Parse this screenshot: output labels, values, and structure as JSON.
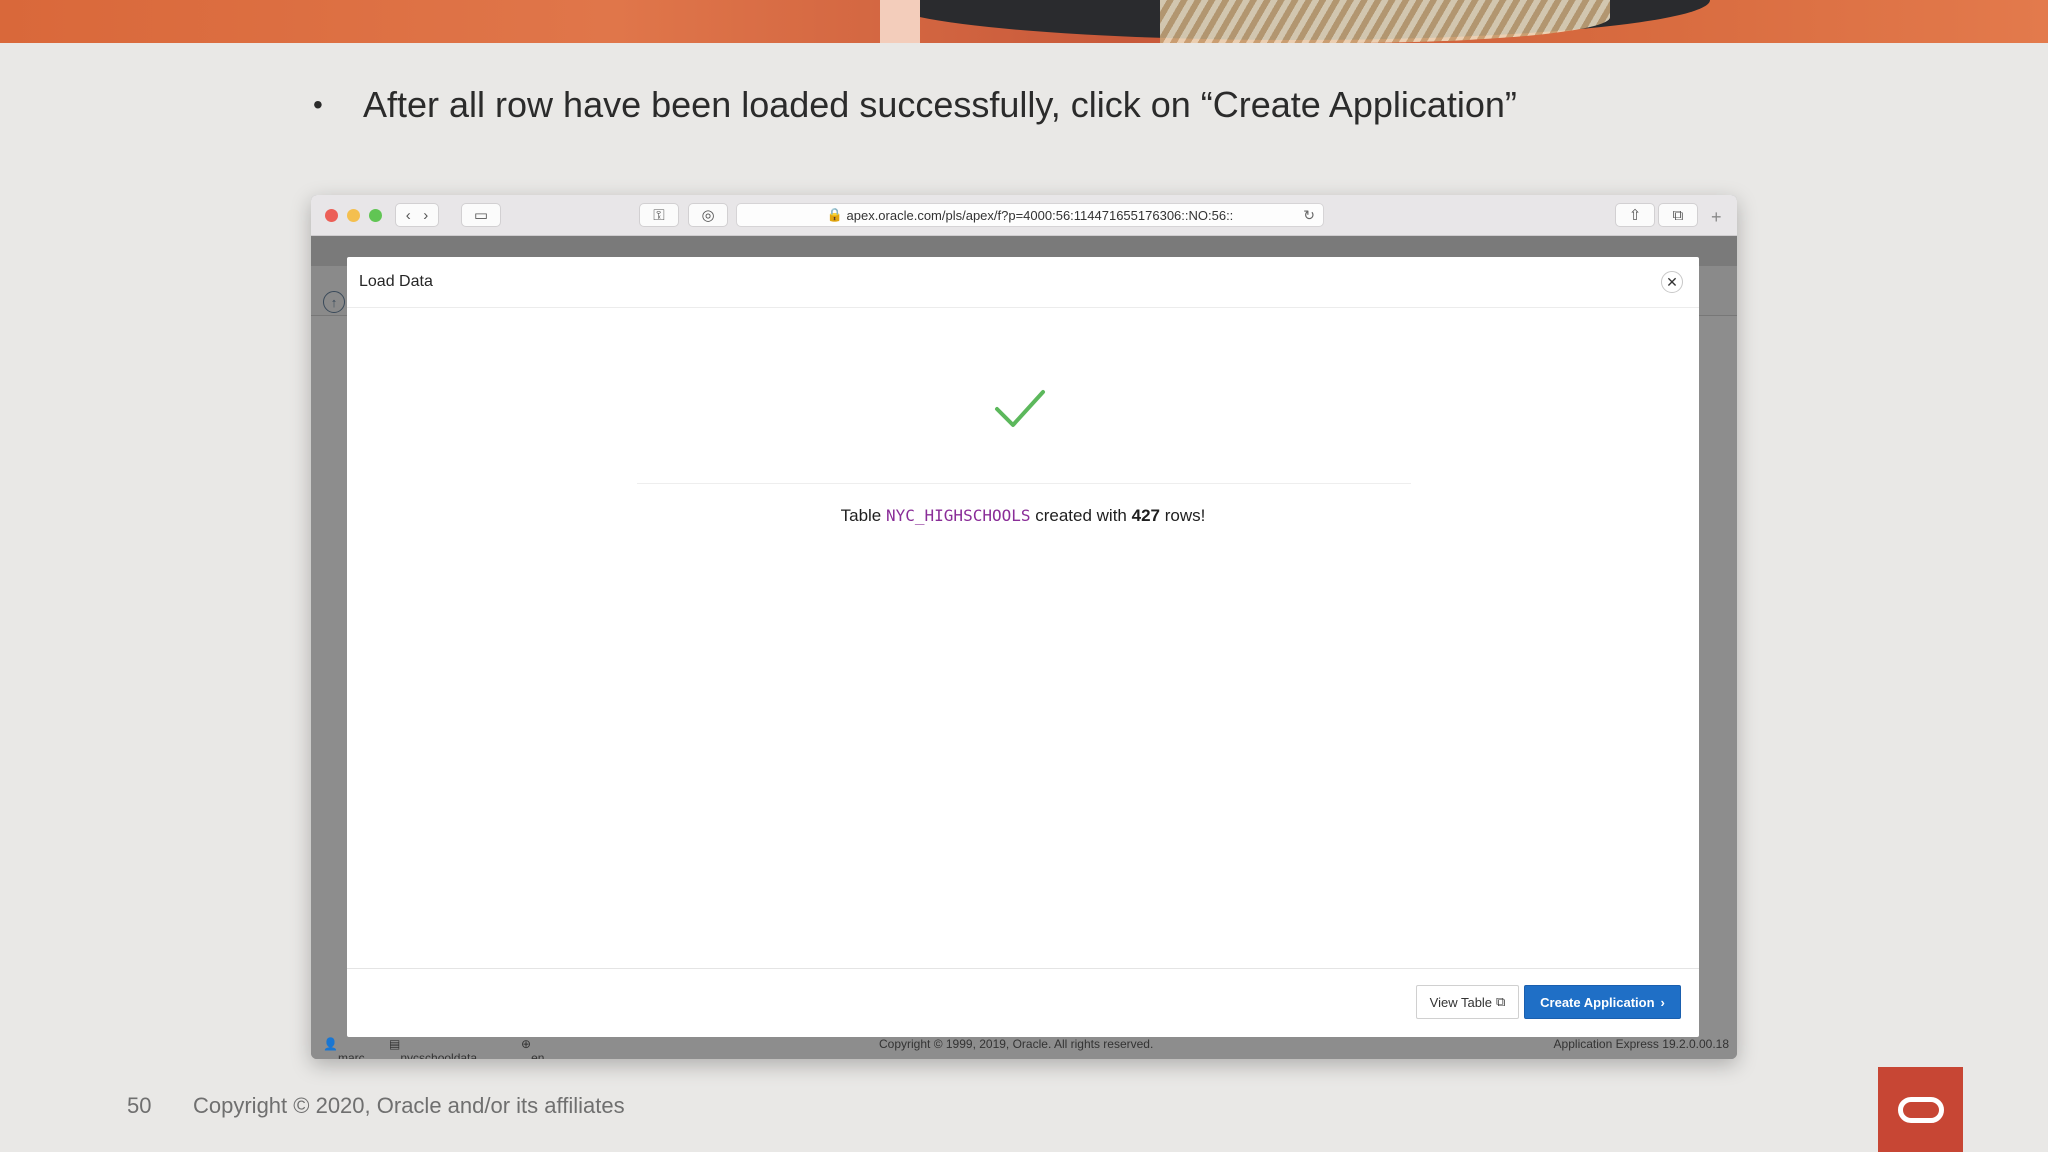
{
  "slide": {
    "bullet_text": "After all row have been loaded successfully, click on “Create Application”",
    "page_number": "50",
    "copyright": "Copyright © 2020, Oracle and/or its affiliates"
  },
  "browser": {
    "url": "apex.oracle.com/pls/apex/f?p=4000:56:114471655176306::NO:56::",
    "footer": {
      "user": "marc",
      "workspace": "nycschooldata",
      "language": "en",
      "copyright": "Copyright © 1999, 2019, Oracle. All rights reserved.",
      "version": "Application Express 19.2.0.00.18"
    }
  },
  "dialog": {
    "title": "Load Data",
    "close_icon": "close-icon",
    "status_icon": "checkmark-icon",
    "status_color": "#5cb85c",
    "message_prefix": "Table",
    "table_name": "NYC_HIGHSCHOOLS",
    "message_middle": "created with",
    "row_count": "427",
    "message_suffix": "rows!",
    "view_table_label": "View Table",
    "create_application_label": "Create Application"
  },
  "colors": {
    "primary_button": "#1f6fc6",
    "table_name": "#8a2e98",
    "oracle_red": "#c74634"
  }
}
